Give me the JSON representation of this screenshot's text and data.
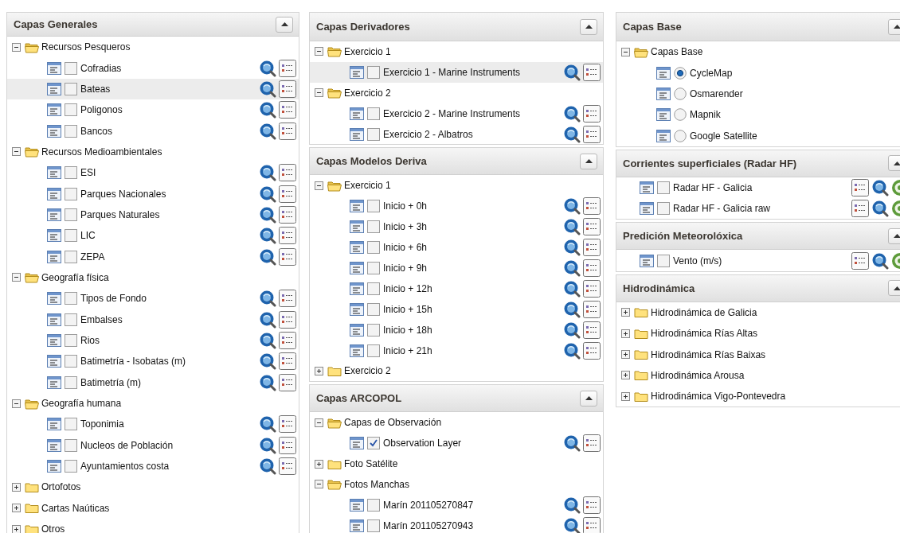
{
  "columns": [
    {
      "panels": [
        {
          "title": "Capas Generales",
          "tree": [
            {
              "kind": "folder",
              "label": "Recursos Pesqueros",
              "expanded": true,
              "children": [
                {
                  "kind": "checkbox",
                  "label": "Cofradias",
                  "checked": false,
                  "highlighted": false,
                  "tools": [
                    {
                      "kind": "zoom"
                    },
                    {
                      "kind": "legend"
                    }
                  ]
                },
                {
                  "kind": "checkbox",
                  "label": "Bateas",
                  "checked": false,
                  "highlighted": true,
                  "tools": [
                    {
                      "kind": "zoom"
                    },
                    {
                      "kind": "legend"
                    }
                  ]
                },
                {
                  "kind": "checkbox",
                  "label": "Poligonos",
                  "checked": false,
                  "highlighted": false,
                  "tools": [
                    {
                      "kind": "zoom"
                    },
                    {
                      "kind": "legend"
                    }
                  ]
                },
                {
                  "kind": "checkbox",
                  "label": "Bancos",
                  "checked": false,
                  "highlighted": false,
                  "tools": [
                    {
                      "kind": "zoom"
                    },
                    {
                      "kind": "legend"
                    }
                  ]
                }
              ]
            },
            {
              "kind": "folder",
              "label": "Recursos Medioambientales",
              "expanded": true,
              "children": [
                {
                  "kind": "checkbox",
                  "label": "ESI",
                  "checked": false,
                  "highlighted": false,
                  "tools": [
                    {
                      "kind": "zoom"
                    },
                    {
                      "kind": "legend"
                    }
                  ]
                },
                {
                  "kind": "checkbox",
                  "label": "Parques Nacionales",
                  "checked": false,
                  "highlighted": false,
                  "tools": [
                    {
                      "kind": "zoom"
                    },
                    {
                      "kind": "legend"
                    }
                  ]
                },
                {
                  "kind": "checkbox",
                  "label": "Parques Naturales",
                  "checked": false,
                  "highlighted": false,
                  "tools": [
                    {
                      "kind": "zoom"
                    },
                    {
                      "kind": "legend"
                    }
                  ]
                },
                {
                  "kind": "checkbox",
                  "label": "LIC",
                  "checked": false,
                  "highlighted": false,
                  "tools": [
                    {
                      "kind": "zoom"
                    },
                    {
                      "kind": "legend"
                    }
                  ]
                },
                {
                  "kind": "checkbox",
                  "label": "ZEPA",
                  "checked": false,
                  "highlighted": false,
                  "tools": [
                    {
                      "kind": "zoom"
                    },
                    {
                      "kind": "legend"
                    }
                  ]
                }
              ]
            },
            {
              "kind": "folder",
              "label": "Geografía física",
              "expanded": true,
              "children": [
                {
                  "kind": "checkbox",
                  "label": "Tipos de Fondo",
                  "checked": false,
                  "highlighted": false,
                  "tools": [
                    {
                      "kind": "zoom"
                    },
                    {
                      "kind": "legend"
                    }
                  ]
                },
                {
                  "kind": "checkbox",
                  "label": "Embalses",
                  "checked": false,
                  "highlighted": false,
                  "tools": [
                    {
                      "kind": "zoom"
                    },
                    {
                      "kind": "legend"
                    }
                  ]
                },
                {
                  "kind": "checkbox",
                  "label": "Rios",
                  "checked": false,
                  "highlighted": false,
                  "tools": [
                    {
                      "kind": "zoom"
                    },
                    {
                      "kind": "legend"
                    }
                  ]
                },
                {
                  "kind": "checkbox",
                  "label": "Batimetría - Isobatas (m)",
                  "checked": false,
                  "highlighted": false,
                  "tools": [
                    {
                      "kind": "zoom"
                    },
                    {
                      "kind": "legend"
                    }
                  ]
                },
                {
                  "kind": "checkbox",
                  "label": "Batimetría (m)",
                  "checked": false,
                  "highlighted": false,
                  "tools": [
                    {
                      "kind": "zoom"
                    },
                    {
                      "kind": "legend"
                    }
                  ]
                }
              ]
            },
            {
              "kind": "folder",
              "label": "Geografía humana",
              "expanded": true,
              "children": [
                {
                  "kind": "checkbox",
                  "label": "Toponimia",
                  "checked": false,
                  "highlighted": false,
                  "tools": [
                    {
                      "kind": "zoom"
                    },
                    {
                      "kind": "legend"
                    }
                  ]
                },
                {
                  "kind": "checkbox",
                  "label": "Nucleos de Población",
                  "checked": false,
                  "highlighted": false,
                  "tools": [
                    {
                      "kind": "zoom"
                    },
                    {
                      "kind": "legend"
                    }
                  ]
                },
                {
                  "kind": "checkbox",
                  "label": "Ayuntamientos costa",
                  "checked": false,
                  "highlighted": false,
                  "tools": [
                    {
                      "kind": "zoom"
                    },
                    {
                      "kind": "legend"
                    }
                  ]
                }
              ]
            },
            {
              "kind": "folder",
              "label": "Ortofotos",
              "expanded": false
            },
            {
              "kind": "folder",
              "label": "Cartas Naúticas",
              "expanded": false
            },
            {
              "kind": "folder",
              "label": "Otros",
              "expanded": false
            }
          ]
        }
      ]
    },
    {
      "panels": [
        {
          "title": "Capas Derivadores",
          "tree": [
            {
              "kind": "folder",
              "label": "Exercicio 1",
              "expanded": true,
              "children": [
                {
                  "kind": "checkbox",
                  "label": "Exercicio 1 - Marine Instruments",
                  "checked": false,
                  "highlighted": true,
                  "tools": [
                    {
                      "kind": "zoom"
                    },
                    {
                      "kind": "legend"
                    }
                  ]
                }
              ]
            },
            {
              "kind": "folder",
              "label": "Exercicio 2",
              "expanded": true,
              "children": [
                {
                  "kind": "checkbox",
                  "label": "Exercicio 2 - Marine Instruments",
                  "checked": false,
                  "highlighted": false,
                  "tools": [
                    {
                      "kind": "zoom"
                    },
                    {
                      "kind": "legend"
                    }
                  ]
                },
                {
                  "kind": "checkbox",
                  "label": "Exercicio 2 - Albatros",
                  "checked": false,
                  "highlighted": false,
                  "tools": [
                    {
                      "kind": "zoom"
                    },
                    {
                      "kind": "legend"
                    }
                  ]
                }
              ]
            }
          ]
        },
        {
          "title": "Capas Modelos Deriva",
          "tree": [
            {
              "kind": "folder",
              "label": "Exercicio 1",
              "expanded": true,
              "children": [
                {
                  "kind": "checkbox",
                  "label": "Inicio + 0h",
                  "checked": false,
                  "highlighted": false,
                  "tools": [
                    {
                      "kind": "zoom"
                    },
                    {
                      "kind": "legend"
                    }
                  ]
                },
                {
                  "kind": "checkbox",
                  "label": "Inicio + 3h",
                  "checked": false,
                  "highlighted": false,
                  "tools": [
                    {
                      "kind": "zoom"
                    },
                    {
                      "kind": "legend"
                    }
                  ]
                },
                {
                  "kind": "checkbox",
                  "label": "Inicio + 6h",
                  "checked": false,
                  "highlighted": false,
                  "tools": [
                    {
                      "kind": "zoom"
                    },
                    {
                      "kind": "legend"
                    }
                  ]
                },
                {
                  "kind": "checkbox",
                  "label": "Inicio + 9h",
                  "checked": false,
                  "highlighted": false,
                  "tools": [
                    {
                      "kind": "zoom"
                    },
                    {
                      "kind": "legend"
                    }
                  ]
                },
                {
                  "kind": "checkbox",
                  "label": "Inicio + 12h",
                  "checked": false,
                  "highlighted": false,
                  "tools": [
                    {
                      "kind": "zoom"
                    },
                    {
                      "kind": "legend"
                    }
                  ]
                },
                {
                  "kind": "checkbox",
                  "label": "Inicio + 15h",
                  "checked": false,
                  "highlighted": false,
                  "tools": [
                    {
                      "kind": "zoom"
                    },
                    {
                      "kind": "legend"
                    }
                  ]
                },
                {
                  "kind": "checkbox",
                  "label": "Inicio + 18h",
                  "checked": false,
                  "highlighted": false,
                  "tools": [
                    {
                      "kind": "zoom"
                    },
                    {
                      "kind": "legend"
                    }
                  ]
                },
                {
                  "kind": "checkbox",
                  "label": "Inicio + 21h",
                  "checked": false,
                  "highlighted": false,
                  "tools": [
                    {
                      "kind": "zoom"
                    },
                    {
                      "kind": "legend"
                    }
                  ]
                }
              ]
            },
            {
              "kind": "folder",
              "label": "Exercicio 2",
              "expanded": false
            }
          ]
        },
        {
          "title": "Capas ARCOPOL",
          "tree": [
            {
              "kind": "folder",
              "label": "Capas de Observación",
              "expanded": true,
              "children": [
                {
                  "kind": "checkbox",
                  "label": "Observation Layer",
                  "checked": true,
                  "highlighted": false,
                  "tools": [
                    {
                      "kind": "zoom"
                    },
                    {
                      "kind": "legend"
                    }
                  ]
                }
              ]
            },
            {
              "kind": "folder",
              "label": "Foto Satélite",
              "expanded": false
            },
            {
              "kind": "folder",
              "label": "Fotos Manchas",
              "expanded": true,
              "children": [
                {
                  "kind": "checkbox",
                  "label": "Marín 201105270847",
                  "checked": false,
                  "highlighted": false,
                  "tools": [
                    {
                      "kind": "zoom"
                    },
                    {
                      "kind": "legend"
                    }
                  ]
                },
                {
                  "kind": "checkbox",
                  "label": "Marín 201105270943",
                  "checked": false,
                  "highlighted": false,
                  "tools": [
                    {
                      "kind": "zoom"
                    },
                    {
                      "kind": "legend"
                    }
                  ]
                }
              ]
            }
          ]
        }
      ]
    },
    {
      "panels": [
        {
          "title": "Capas Base",
          "tree": [
            {
              "kind": "folder",
              "label": "Capas Base",
              "expanded": true,
              "children": [
                {
                  "kind": "radio",
                  "label": "CycleMap",
                  "selected": true,
                  "highlighted": false
                },
                {
                  "kind": "radio",
                  "label": "Osmarender",
                  "selected": false,
                  "highlighted": false
                },
                {
                  "kind": "radio",
                  "label": "Mapnik",
                  "selected": false,
                  "highlighted": false
                },
                {
                  "kind": "radio",
                  "label": "Google Satellite",
                  "selected": false,
                  "highlighted": false
                }
              ]
            }
          ]
        },
        {
          "title": "Corrientes superficiales (Radar HF)",
          "tree": [
            {
              "kind": "checkbox",
              "label": "Radar HF - Galicia",
              "checked": false,
              "highlighted": false,
              "tools": [
                {
                  "kind": "legend"
                },
                {
                  "kind": "zoom"
                },
                {
                  "kind": "style"
                }
              ]
            },
            {
              "kind": "checkbox",
              "label": "Radar HF - Galicia raw",
              "checked": false,
              "highlighted": false,
              "tools": [
                {
                  "kind": "legend"
                },
                {
                  "kind": "zoom"
                },
                {
                  "kind": "style"
                }
              ]
            }
          ]
        },
        {
          "title": "Predición Meteorolóxica",
          "tree": [
            {
              "kind": "checkbox",
              "label": "Vento (m/s)",
              "checked": false,
              "highlighted": false,
              "tools": [
                {
                  "kind": "legend"
                },
                {
                  "kind": "zoom"
                },
                {
                  "kind": "style"
                }
              ]
            }
          ]
        },
        {
          "title": "Hidrodinámica",
          "tree": [
            {
              "kind": "folder",
              "label": "Hidrodinámica de Galicia",
              "expanded": false
            },
            {
              "kind": "folder",
              "label": "Hidrodinámica Rías Altas",
              "expanded": false
            },
            {
              "kind": "folder",
              "label": "Hidrodinámica Rías Baixas",
              "expanded": false
            },
            {
              "kind": "folder",
              "label": "Hidrodinámica Arousa",
              "expanded": false
            },
            {
              "kind": "folder",
              "label": "Hidrodinámica Vigo-Pontevedra",
              "expanded": false
            }
          ]
        }
      ]
    }
  ]
}
